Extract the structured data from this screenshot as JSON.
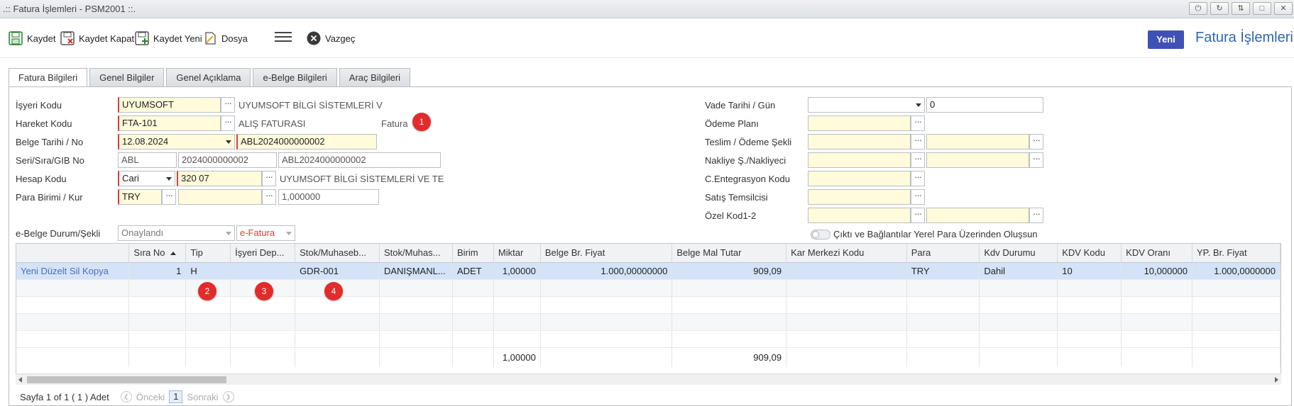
{
  "window": {
    "title": ".:: Fatura İşlemleri - PSM2001 ::.",
    "buttons": [
      "pin",
      "refresh",
      "restore",
      "maximize",
      "close"
    ]
  },
  "toolbar": {
    "save": "Kaydet",
    "save_close": "Kaydet Kapat",
    "save_new": "Kaydet Yeni",
    "file": "Dosya",
    "cancel": "Vazgeç",
    "new_badge": "Yeni",
    "page_title": "Fatura İşlemleri",
    "accent_color": "#3f51b5"
  },
  "tabs": [
    "Fatura Bilgileri",
    "Genel Bilgiler",
    "Genel Açıklama",
    "e-Belge Bilgileri",
    "Araç Bilgileri"
  ],
  "form_left": {
    "isyeri": {
      "label": "İşyeri Kodu",
      "code": "UYUMSOFT",
      "desc": "UYUMSOFT BİLGİ SİSTEMLERİ V"
    },
    "hareket": {
      "label": "Hareket Kodu",
      "code": "FTA-101",
      "desc": "ALIŞ FATURASI",
      "type": "Fatura"
    },
    "belge": {
      "label": "Belge Tarihi / No",
      "date": "12.08.2024",
      "no": "ABL2024000000002"
    },
    "seri": {
      "label": "Seri/Sıra/GIB No",
      "seri": "ABL",
      "sira": "2024000000002",
      "gib": "ABL2024000000002"
    },
    "hesap": {
      "label": "Hesap Kodu",
      "type": "Cari",
      "code": "320 07",
      "desc": "UYUMSOFT BİLGİ SİSTEMLERİ VE TE"
    },
    "para": {
      "label": "Para Birimi / Kur",
      "currency": "TRY",
      "second": "",
      "rate": "1,000000"
    },
    "ebelge": {
      "label": "e-Belge Durum/Şekli",
      "status": "Onaylandı",
      "type": "e-Fatura"
    }
  },
  "form_right": {
    "vade": {
      "label": "Vade Tarihi / Gün",
      "date": "",
      "days": "0"
    },
    "odeme_plani": {
      "label": "Ödeme Planı",
      "value": ""
    },
    "teslim": {
      "label": "Teslim / Ödeme Şekli",
      "value1": "",
      "value2": ""
    },
    "nakliye": {
      "label": "Nakliye Ş./Nakliyeci",
      "value1": "",
      "value2": ""
    },
    "entegrasyon": {
      "label": "C.Entegrasyon Kodu",
      "value": ""
    },
    "temsilci": {
      "label": "Satış Temsilcisi",
      "value": ""
    },
    "ozel": {
      "label": "Özel Kod1-2",
      "value1": "",
      "value2": ""
    },
    "toggle_label": "Çıktı ve Bağlantılar Yerel Para Üzerinden Oluşsun"
  },
  "badges": [
    "1",
    "2",
    "3",
    "4"
  ],
  "grid": {
    "columns": [
      "",
      "Sıra No",
      "Tip",
      "İşyeri Dep...",
      "Stok/Muhaseb...",
      "Stok/Muhas...",
      "Birim",
      "Miktar",
      "Belge Br. Fiyat",
      "Belge Mal Tutar",
      "Kar Merkezi Kodu",
      "Para",
      "Kdv Durumu",
      "KDV Kodu",
      "KDV Oranı",
      "YP. Br. Fiyat"
    ],
    "row_actions": "Yeni Düzelt Sil Kopya",
    "rows": [
      [
        "1",
        "H",
        "",
        "GDR-001",
        "DANIŞMANL...",
        "ADET",
        "1,00000",
        "1.000,00000000",
        "909,09",
        "",
        "TRY",
        "Dahil",
        "10",
        "10,000000",
        "1.000,0000000"
      ]
    ],
    "totals": {
      "miktar": "1,00000",
      "mal_tutar": "909,09"
    }
  },
  "pager": {
    "info": "Sayfa 1 of 1 ( 1 ) Adet",
    "prev": "Önceki",
    "page": "1",
    "next": "Sonraki"
  }
}
